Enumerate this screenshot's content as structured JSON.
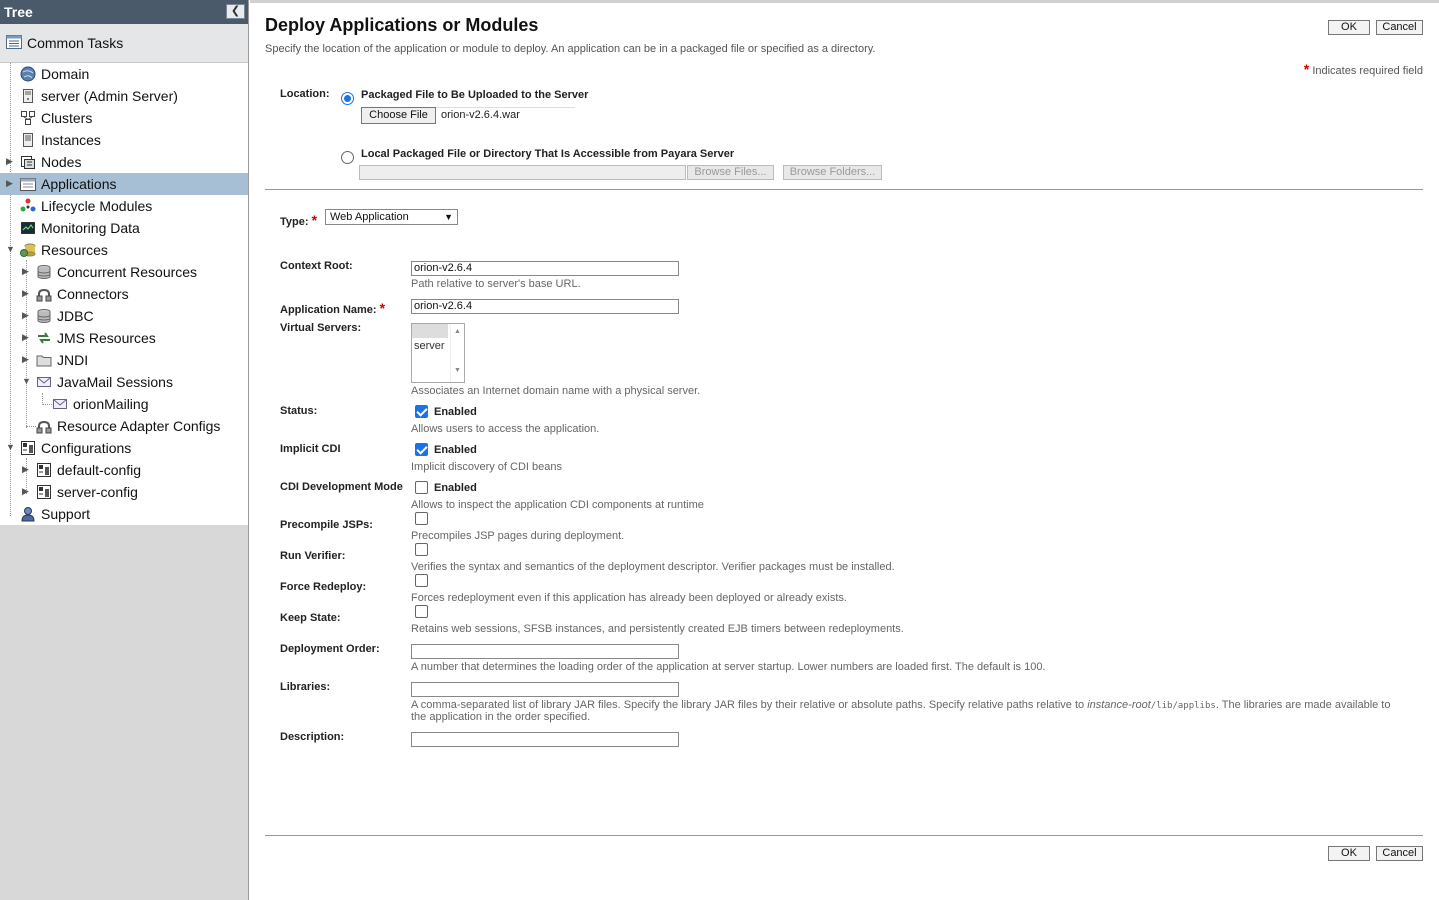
{
  "sidebar": {
    "title": "Tree",
    "common_tasks": "Common Tasks",
    "nodes": [
      {
        "label": "Domain"
      },
      {
        "label": "server (Admin Server)"
      },
      {
        "label": "Clusters"
      },
      {
        "label": "Instances"
      },
      {
        "label": "Nodes"
      },
      {
        "label": "Applications"
      },
      {
        "label": "Lifecycle Modules"
      },
      {
        "label": "Monitoring Data"
      },
      {
        "label": "Resources"
      },
      {
        "label": "Concurrent Resources"
      },
      {
        "label": "Connectors"
      },
      {
        "label": "JDBC"
      },
      {
        "label": "JMS Resources"
      },
      {
        "label": "JNDI"
      },
      {
        "label": "JavaMail Sessions"
      },
      {
        "label": "orionMailing"
      },
      {
        "label": "Resource Adapter Configs"
      },
      {
        "label": "Configurations"
      },
      {
        "label": "default-config"
      },
      {
        "label": "server-config"
      },
      {
        "label": "Support"
      }
    ]
  },
  "page": {
    "title": "Deploy Applications or Modules",
    "help": "Specify the location of the application or module to deploy. An application can be in a packaged file or specified as a directory.",
    "required_note": "Indicates required field",
    "required_star": "*",
    "ok": "OK",
    "cancel": "Cancel"
  },
  "location": {
    "label": "Location:",
    "option1": "Packaged File to Be Uploaded to the Server",
    "choose_file": "Choose File",
    "file_name": "orion-v2.6.4.war",
    "option2": "Local Packaged File or Directory That Is Accessible from Payara Server",
    "browse_files": "Browse Files...",
    "browse_folders": "Browse Folders..."
  },
  "type": {
    "label": "Type:",
    "value": "Web Application"
  },
  "form": {
    "context_root": {
      "label": "Context Root:",
      "value": "orion-v2.6.4",
      "help": "Path relative to server's base URL."
    },
    "app_name": {
      "label": "Application Name:",
      "value": "orion-v2.6.4"
    },
    "virtual_servers": {
      "label": "Virtual Servers:",
      "option": "server",
      "help": "Associates an Internet domain name with a physical server."
    },
    "status": {
      "label": "Status:",
      "checkbox": "Enabled",
      "help": "Allows users to access the application."
    },
    "implicit_cdi": {
      "label": "Implicit CDI",
      "checkbox": "Enabled",
      "help": "Implicit discovery of CDI beans"
    },
    "cdi_dev": {
      "label": "CDI Development Mode",
      "checkbox": "Enabled",
      "help": "Allows to inspect the application CDI components at runtime"
    },
    "precompile": {
      "label": "Precompile JSPs:",
      "help": "Precompiles JSP pages during deployment."
    },
    "run_verifier": {
      "label": "Run Verifier:",
      "help": "Verifies the syntax and semantics of the deployment descriptor. Verifier packages must be installed."
    },
    "force_redeploy": {
      "label": "Force Redeploy:",
      "help": "Forces redeployment even if this application has already been deployed or already exists."
    },
    "keep_state": {
      "label": "Keep State:",
      "help": "Retains web sessions, SFSB instances, and persistently created EJB timers between redeployments."
    },
    "deploy_order": {
      "label": "Deployment Order:",
      "value": "",
      "help": "A number that determines the loading order of the application at server startup. Lower numbers are loaded first. The default is 100."
    },
    "libraries": {
      "label": "Libraries:",
      "value": "",
      "help_a": "A comma-separated list of library JAR files. Specify the library JAR files by their relative or absolute paths. Specify relative paths relative to ",
      "help_b": "instance-root",
      "help_c": "/lib/applibs",
      "help_d": ". The libraries are made available to",
      "help_e": "the application in the order specified."
    },
    "description": {
      "label": "Description:",
      "value": ""
    }
  }
}
